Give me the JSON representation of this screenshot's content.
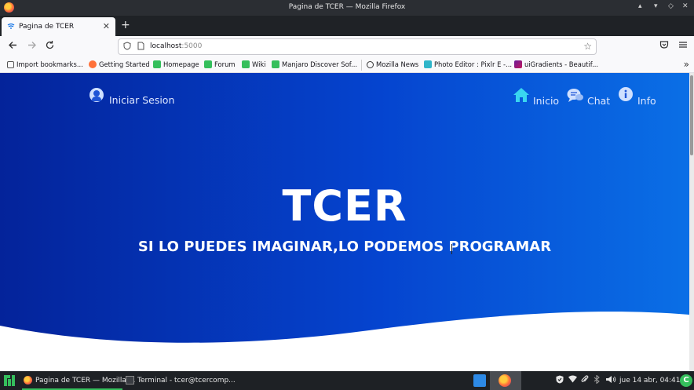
{
  "window": {
    "title": "Pagina de TCER — Mozilla Firefox",
    "controls": [
      "▴",
      "▾",
      "◇",
      "✕"
    ]
  },
  "tabs": [
    {
      "label": "Pagina de TCER",
      "close": "✕",
      "active": true
    }
  ],
  "newtab_label": "+",
  "nav": {
    "url_host": "localhost",
    "url_port": ":5000"
  },
  "bookmarks": [
    {
      "label": "Import bookmarks...",
      "icon": "import-icon",
      "color": "#555555"
    },
    {
      "label": "Getting Started",
      "icon": "firefox-icon",
      "color": "#ff7139"
    },
    {
      "label": "Homepage",
      "icon": "manjaro-icon",
      "color": "#35bf5c"
    },
    {
      "label": "Forum",
      "icon": "manjaro-icon",
      "color": "#35bf5c"
    },
    {
      "label": "Wiki",
      "icon": "manjaro-icon",
      "color": "#35bf5c"
    },
    {
      "label": "Manjaro Discover Sof...",
      "icon": "manjaro-icon",
      "color": "#35bf5c"
    },
    {
      "label": "Mozilla News",
      "icon": "globe-icon",
      "color": "#333333"
    },
    {
      "label": "Photo Editor : Pixlr E -...",
      "icon": "pixlr-icon",
      "color": "#2fb5c9"
    },
    {
      "label": "uiGradients - Beautif...",
      "icon": "uigradients-icon",
      "color": "#c2185b"
    }
  ],
  "page": {
    "login_label": "Iniciar Sesion",
    "menu": [
      {
        "label": "Inicio",
        "icon": "home-icon"
      },
      {
        "label": "Chat",
        "icon": "chat-icon"
      },
      {
        "label": "Info",
        "icon": "info-icon"
      }
    ],
    "title": "TCER",
    "subtitle": "SI LO PUEDES IMAGINAR,LO PODEMOS PROGRAMAR",
    "colors": {
      "gradient_start": "#04239a",
      "gradient_end": "#0a6fe6",
      "wave": "#ffffff"
    }
  },
  "taskbar": {
    "tasks": [
      {
        "label": "Pagina de TCER — Mozilla ...",
        "icon": "firefox-icon",
        "active": true
      },
      {
        "label": "Terminal - tcer@tcercomp...",
        "icon": "terminal-icon",
        "active": false
      }
    ],
    "clock": "jue 14 abr, 04:41",
    "update_label": "C"
  }
}
